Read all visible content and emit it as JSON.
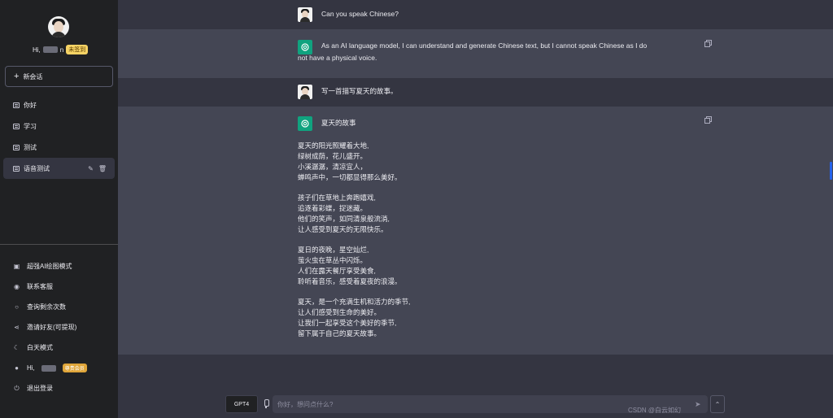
{
  "profile": {
    "name": "Hi,",
    "name_suffix": "n",
    "badge": "未签到"
  },
  "new_chat_label": "新会话",
  "conversations": [
    {
      "label": "你好"
    },
    {
      "label": "学习"
    },
    {
      "label": "测试"
    },
    {
      "label": "语音测试"
    }
  ],
  "bottom_menu": [
    {
      "icon": "image-icon",
      "glyph": "▣",
      "label": "超强AI绘图模式"
    },
    {
      "icon": "chat-bubble-icon",
      "glyph": "◉",
      "label": "联系客服"
    },
    {
      "icon": "search-icon",
      "glyph": "○",
      "label": "查询剩余次数"
    },
    {
      "icon": "share-icon",
      "glyph": "⋖",
      "label": "邀请好友(可提现)"
    },
    {
      "icon": "moon-icon",
      "glyph": "☾",
      "label": "白天模式"
    },
    {
      "icon": "user-icon",
      "glyph": "●",
      "label": "Hi,",
      "badge": "尊贵会员"
    },
    {
      "icon": "power-icon",
      "glyph": "⏻",
      "label": "退出登录"
    }
  ],
  "messages": {
    "m1_user": "Can you speak Chinese?",
    "m2_ai": "As an AI language model, I can understand and generate Chinese text, but I cannot speak Chinese as I do not have a physical voice.",
    "m3_user": "写一首描写夏天的故事。",
    "m4_ai_title": "夏天的故事",
    "poem": [
      [
        "夏天的阳光照耀着大地,",
        "绿树成荫，花儿盛开。",
        "小溪潺潺，清凉宜人，",
        "蝉鸣声中，一切都显得那么美好。"
      ],
      [
        "孩子们在草地上奔跑嬉戏,",
        "追逐着彩蝶，捉迷藏。",
        "他们的笑声，如同清泉般流淌,",
        "让人感受到夏天的无限快乐。"
      ],
      [
        "夏日的夜晚，星空灿烂,",
        "萤火虫在草丛中闪烁。",
        "人们在露天餐厅享受美食,",
        "聆听着音乐，感受着夏夜的浪漫。"
      ],
      [
        "夏天，是一个充满生机和活力的季节,",
        "让人们感受到生命的美好。",
        "让我们一起享受这个美好的季节,",
        "留下属于自己的夏天故事。"
      ]
    ]
  },
  "input": {
    "model_label": "GPT4",
    "placeholder": "你好，想问点什么?"
  },
  "watermark": "CSDN @白云如幻",
  "colors": {
    "accent": "#10a37f",
    "sidebar": "#202123",
    "main": "#343541",
    "ai_row": "#444654"
  }
}
